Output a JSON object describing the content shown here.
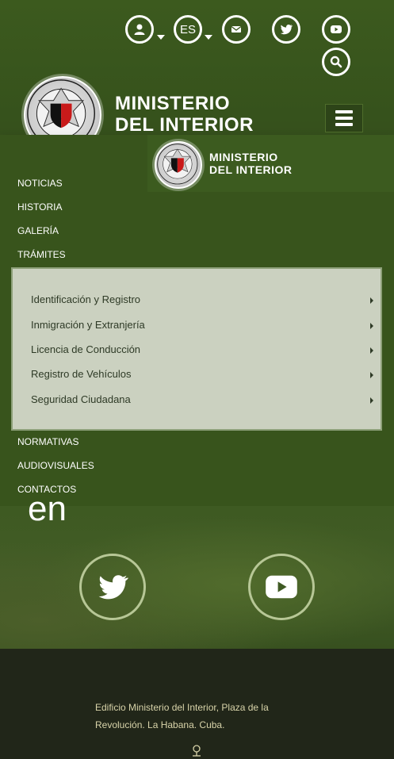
{
  "header": {
    "language": "ES",
    "brand": {
      "line1": "MINISTERIO",
      "line2": "DEL INTERIOR"
    },
    "icons": [
      "user-icon",
      "language-icon",
      "mail-icon",
      "twitter-icon",
      "youtube-icon",
      "search-icon",
      "menu-icon"
    ]
  },
  "nav": {
    "brand": {
      "line1": "MINISTERIO",
      "line2": "DEL INTERIOR"
    },
    "items": [
      "NOTICIAS",
      "HISTORIA",
      "GALERÍA",
      "TRÁMITES",
      "NORMATIVAS",
      "AUDIOVISUALES",
      "CONTACTOS"
    ],
    "submenu": [
      "Identificación y Registro",
      "Inmigración y Extranjería",
      "Licencia de Conducción",
      "Registro de Vehículos",
      "Seguridad Ciudadana"
    ]
  },
  "hero": {
    "word": "en",
    "icons": [
      "twitter-icon",
      "youtube-icon"
    ]
  },
  "footer": {
    "address_line1": "Edificio Ministerio del Interior, Plaza de la",
    "address_line2": "Revolución. La Habana. Cuba."
  },
  "colors": {
    "header_green": "#3c5a1e",
    "nav_green": "#38541c",
    "submenu_bg": "#cbd1c0",
    "footer_bg": "#212619",
    "footer_text": "#d8d3a9"
  }
}
